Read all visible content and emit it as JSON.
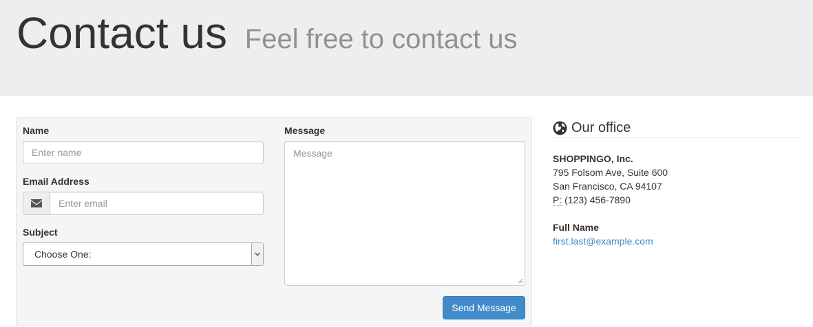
{
  "header": {
    "title": "Contact us",
    "subtitle": "Feel free to contact us"
  },
  "form": {
    "name_label": "Name",
    "name_placeholder": "Enter name",
    "email_label": "Email Address",
    "email_placeholder": "Enter email",
    "email_icon": "envelope-icon",
    "subject_label": "Subject",
    "subject_selected": "Choose One:",
    "message_label": "Message",
    "message_placeholder": "Message",
    "submit_label": "Send Message"
  },
  "office": {
    "heading": "Our office",
    "heading_icon": "globe-icon",
    "company": "SHOPPINGO, Inc.",
    "street": "795 Folsom Ave, Suite 600",
    "city": "San Francisco, CA 94107",
    "phone_abbr": "P:",
    "phone": "(123) 456-7890",
    "contact_name": "Full Name",
    "contact_email": "first.last@example.com"
  },
  "colors": {
    "jumbotron_bg": "#eeeeee",
    "well_bg": "#f5f5f5",
    "primary_button": "#428bca",
    "link": "#428bca"
  }
}
